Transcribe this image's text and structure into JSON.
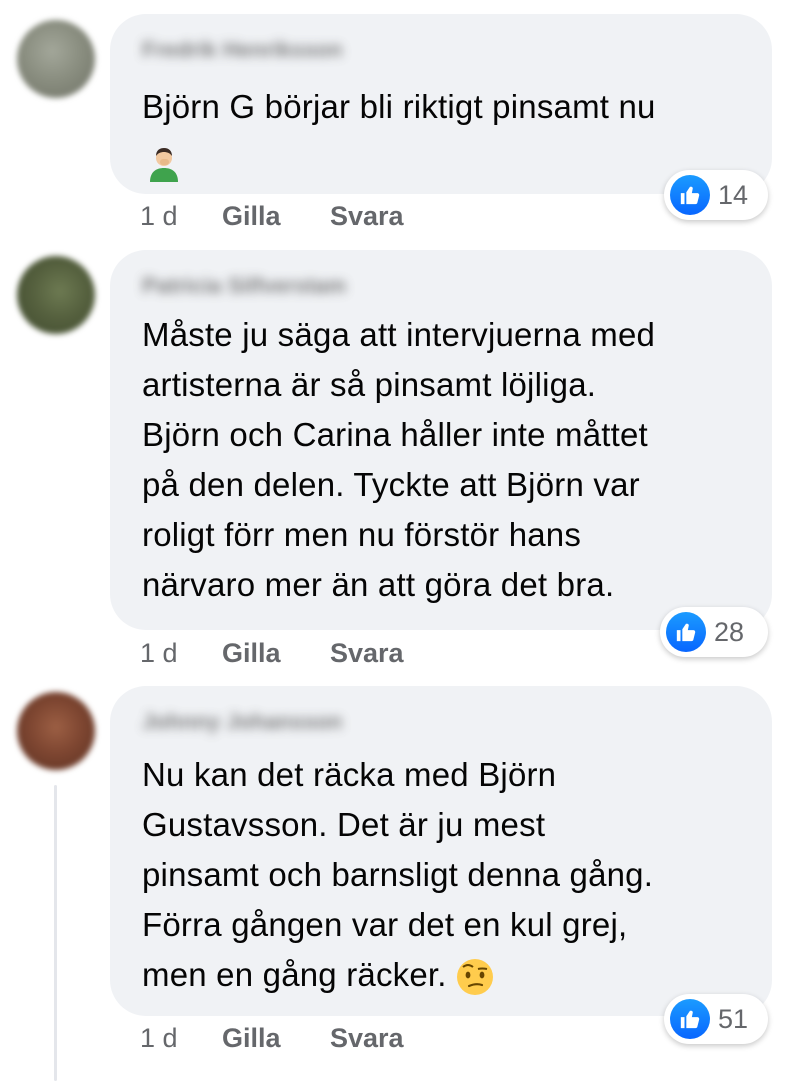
{
  "comments": [
    {
      "author": "Fredrik Henriksson",
      "text": "Björn G börjar bli riktigt pinsamt nu",
      "emoji": "person-facepalm-emoji",
      "reactions": {
        "icon": "like-icon",
        "count": "14"
      },
      "meta": {
        "time": "1 d",
        "like": "Gilla",
        "reply": "Svara"
      }
    },
    {
      "author": "Patricia Silfverstam",
      "text": "Måste ju säga att intervjuerna med\nartisterna är så pinsamt löjliga.\nBjörn och Carina håller inte måttet\npå den delen. Tyckte att Björn var\nroligt förr men nu förstör hans\nnärvaro mer än att göra det bra.",
      "reactions": {
        "icon": "like-icon",
        "count": "28"
      },
      "meta": {
        "time": "1 d",
        "like": "Gilla",
        "reply": "Svara"
      }
    },
    {
      "author": "Johnny Johansson",
      "text": "Nu kan det räcka med Björn\nGustavsson. Det är ju mest\npinsamt och barnsligt denna gång.\nFörra gången var det en kul grej,\nmen en gång räcker.",
      "emoji": "face-with-raised-eyebrow-emoji",
      "reactions": {
        "icon": "like-icon",
        "count": "51"
      },
      "meta": {
        "time": "1 d",
        "like": "Gilla",
        "reply": "Svara"
      }
    }
  ],
  "colors": {
    "bubble": "#f0f2f5",
    "secondary_text": "#65676b",
    "like_blue": "#0866ff"
  }
}
